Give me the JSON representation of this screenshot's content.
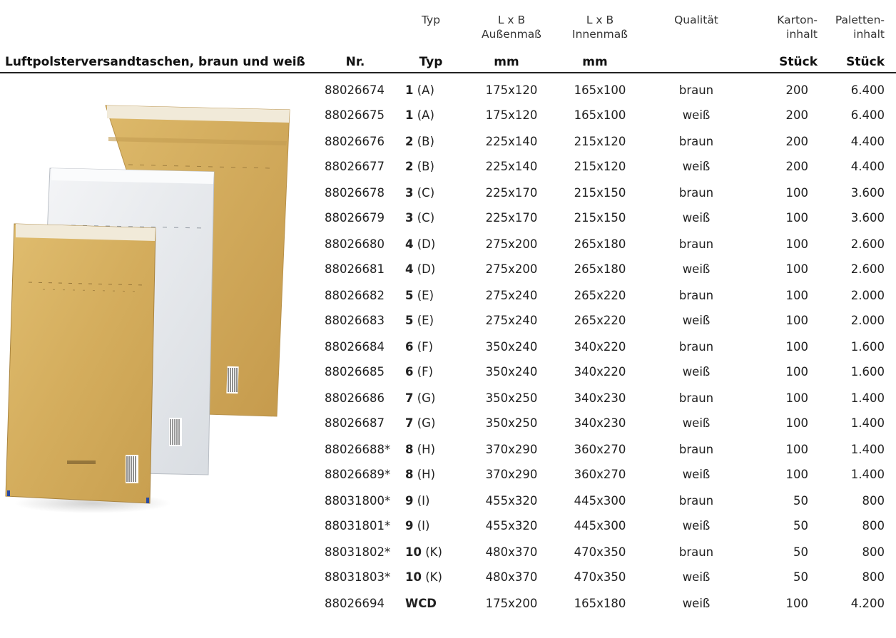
{
  "header_top": {
    "typ": "Typ",
    "lxb_outer_1": "L x B",
    "lxb_outer_2": "Außenmaß",
    "lxb_inner_1": "L x B",
    "lxb_inner_2": "Innenmaß",
    "qualitaet": "Qualität",
    "karton_1": "Karton-",
    "karton_2": "inhalt",
    "palette_1": "Paletten-",
    "palette_2": "inhalt"
  },
  "header_bold": {
    "title": "Luftpolsterversandtaschen, braun und weiß",
    "nr": "Nr.",
    "typ": "Typ",
    "mm_outer": "mm",
    "mm_inner": "mm",
    "stueck_karton": "Stück",
    "stueck_palette": "Stück"
  },
  "rows": [
    {
      "nr": "88026674",
      "typ_num": "1",
      "typ_letter": " (A)",
      "outer": "175x120",
      "inner": "165x100",
      "quality": "braun",
      "karton": "200",
      "palette": "6.400"
    },
    {
      "nr": "88026675",
      "typ_num": "1",
      "typ_letter": " (A)",
      "outer": "175x120",
      "inner": "165x100",
      "quality": "weiß",
      "karton": "200",
      "palette": "6.400"
    },
    {
      "nr": "88026676",
      "typ_num": "2",
      "typ_letter": " (B)",
      "outer": "225x140",
      "inner": "215x120",
      "quality": "braun",
      "karton": "200",
      "palette": "4.400"
    },
    {
      "nr": "88026677",
      "typ_num": "2",
      "typ_letter": " (B)",
      "outer": "225x140",
      "inner": "215x120",
      "quality": "weiß",
      "karton": "200",
      "palette": "4.400"
    },
    {
      "nr": "88026678",
      "typ_num": "3",
      "typ_letter": " (C)",
      "outer": "225x170",
      "inner": "215x150",
      "quality": "braun",
      "karton": "100",
      "palette": "3.600"
    },
    {
      "nr": "88026679",
      "typ_num": "3",
      "typ_letter": " (C)",
      "outer": "225x170",
      "inner": "215x150",
      "quality": "weiß",
      "karton": "100",
      "palette": "3.600"
    },
    {
      "nr": "88026680",
      "typ_num": "4",
      "typ_letter": " (D)",
      "outer": "275x200",
      "inner": "265x180",
      "quality": "braun",
      "karton": "100",
      "palette": "2.600"
    },
    {
      "nr": "88026681",
      "typ_num": "4",
      "typ_letter": " (D)",
      "outer": "275x200",
      "inner": "265x180",
      "quality": "weiß",
      "karton": "100",
      "palette": "2.600"
    },
    {
      "nr": "88026682",
      "typ_num": "5",
      "typ_letter": " (E)",
      "outer": "275x240",
      "inner": "265x220",
      "quality": "braun",
      "karton": "100",
      "palette": "2.000"
    },
    {
      "nr": "88026683",
      "typ_num": "5",
      "typ_letter": " (E)",
      "outer": "275x240",
      "inner": "265x220",
      "quality": "weiß",
      "karton": "100",
      "palette": "2.000"
    },
    {
      "nr": "88026684",
      "typ_num": "6",
      "typ_letter": " (F)",
      "outer": "350x240",
      "inner": "340x220",
      "quality": "braun",
      "karton": "100",
      "palette": "1.600"
    },
    {
      "nr": "88026685",
      "typ_num": "6",
      "typ_letter": " (F)",
      "outer": "350x240",
      "inner": "340x220",
      "quality": "weiß",
      "karton": "100",
      "palette": "1.600"
    },
    {
      "nr": "88026686",
      "typ_num": "7",
      "typ_letter": " (G)",
      "outer": "350x250",
      "inner": "340x230",
      "quality": "braun",
      "karton": "100",
      "palette": "1.400"
    },
    {
      "nr": "88026687",
      "typ_num": "7",
      "typ_letter": " (G)",
      "outer": "350x250",
      "inner": "340x230",
      "quality": "weiß",
      "karton": "100",
      "palette": "1.400"
    },
    {
      "nr": "88026688*",
      "typ_num": "8",
      "typ_letter": " (H)",
      "outer": "370x290",
      "inner": "360x270",
      "quality": "braun",
      "karton": "100",
      "palette": "1.400"
    },
    {
      "nr": "88026689*",
      "typ_num": "8",
      "typ_letter": " (H)",
      "outer": "370x290",
      "inner": "360x270",
      "quality": "weiß",
      "karton": "100",
      "palette": "1.400"
    },
    {
      "nr": "88031800*",
      "typ_num": "9",
      "typ_letter": " (I)",
      "outer": "455x320",
      "inner": "445x300",
      "quality": "braun",
      "karton": "50",
      "palette": "800"
    },
    {
      "nr": "88031801*",
      "typ_num": "9",
      "typ_letter": " (I)",
      "outer": "455x320",
      "inner": "445x300",
      "quality": "weiß",
      "karton": "50",
      "palette": "800"
    },
    {
      "nr": "88031802*",
      "typ_num": "10",
      "typ_letter": " (K)",
      "outer": "480x370",
      "inner": "470x350",
      "quality": "braun",
      "karton": "50",
      "palette": "800"
    },
    {
      "nr": "88031803*",
      "typ_num": "10",
      "typ_letter": " (K)",
      "outer": "480x370",
      "inner": "470x350",
      "quality": "weiß",
      "karton": "50",
      "palette": "800"
    },
    {
      "nr": "88026694",
      "typ_num": "WCD",
      "typ_letter": "",
      "outer": "175x200",
      "inner": "165x180",
      "quality": "weiß",
      "karton": "100",
      "palette": "4.200"
    }
  ],
  "icons": {
    "product_photo": "padded-envelopes-image"
  },
  "colors": {
    "kraft": "#d3ad5e",
    "white_env": "#e8ebee",
    "rule": "#222222"
  }
}
